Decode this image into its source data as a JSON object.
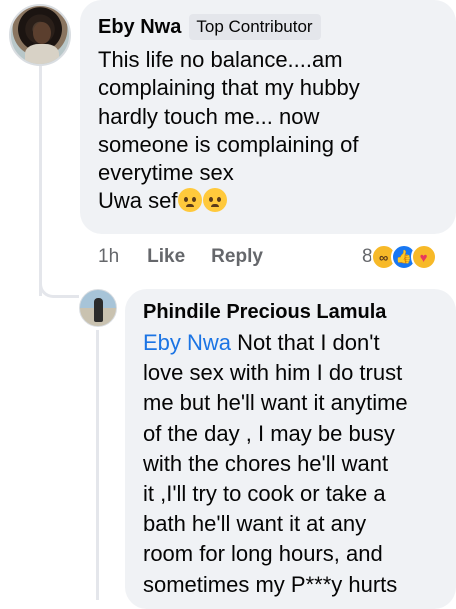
{
  "comment": {
    "author": "Eby Nwa",
    "badge": "Top Contributor",
    "text": "This life no balance....am\ncomplaining that my hubby\nhardly touch me... now\nsomeone is complaining of\neverytime sex\nUwa sef",
    "trailing_emojis": [
      "sad-face-emoji",
      "sad-face-emoji"
    ],
    "time": "1h",
    "like_label": "Like",
    "reply_label": "Reply",
    "reaction_count": "8",
    "reaction_icons": [
      "haha-reaction-icon",
      "like-reaction-icon",
      "care-reaction-icon"
    ]
  },
  "reply": {
    "author": "Phindile Precious Lamula",
    "mention": "Eby Nwa",
    "text": " Not that I don't\nlove sex with him I do trust\nme but he'll want it anytime\nof the day , I may be busy\nwith the chores he'll want\nit ,I'll try to cook or take a\nbath he'll want it at any\nroom for long hours, and\nsometimes my P***y hurts"
  },
  "colors": {
    "bubble": "#f0f2f5",
    "mention": "#1b74e4",
    "meta_text": "#65676b",
    "like_blue": "#1877f2"
  }
}
